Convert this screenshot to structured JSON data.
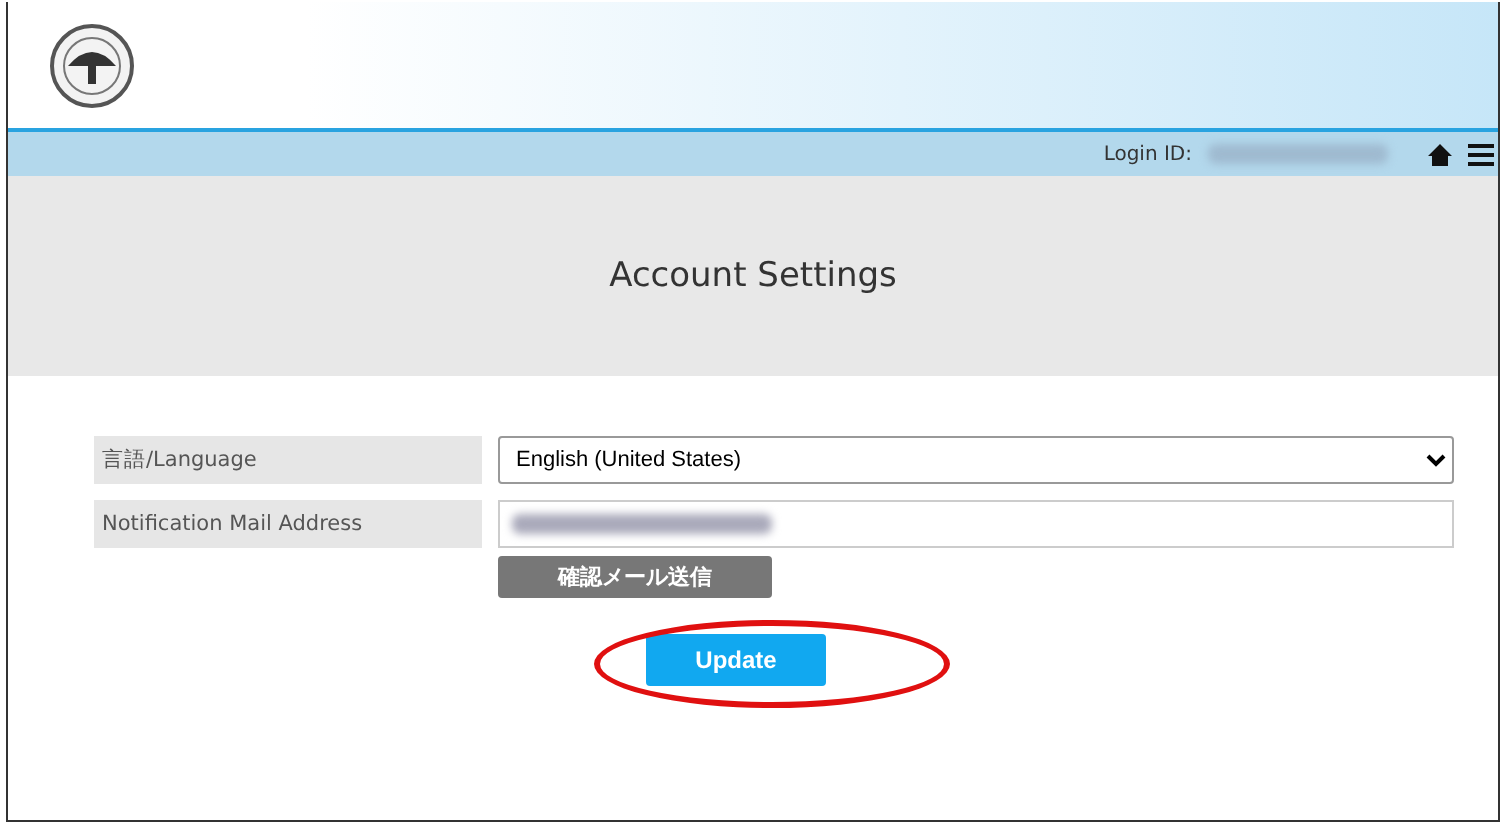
{
  "header": {
    "login_label": "Login ID:"
  },
  "page_title": "Account Settings",
  "form": {
    "rows": [
      {
        "kind": "select",
        "label": "言語/Language",
        "value": "English (United States)"
      },
      {
        "kind": "email",
        "label": "Notification Mail Address"
      }
    ],
    "confirm_button": "確認メール送信",
    "update_button": "Update"
  }
}
